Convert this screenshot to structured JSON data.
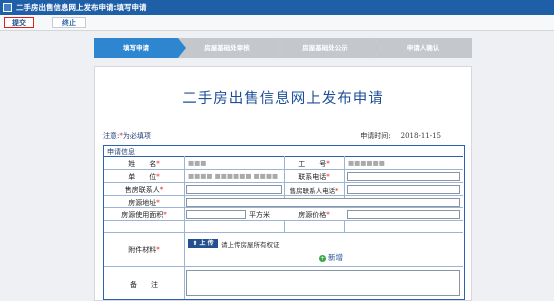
{
  "window": {
    "title": "二手房出售信息网上发布申请:填写申请"
  },
  "toolbar": {
    "submit_label": "提交",
    "stop_label": "终止"
  },
  "steps": [
    {
      "label": "填写申请",
      "active": true
    },
    {
      "label": "房屋基础处审核",
      "active": false
    },
    {
      "label": "房屋基础处公示",
      "active": false
    },
    {
      "label": "申请人确认",
      "active": false
    }
  ],
  "form": {
    "title": "二手房出售信息网上发布申请",
    "notice_prefix": "注意:",
    "notice_star": "*",
    "notice_text": "为必填项",
    "apply_time_label": "申请时间:",
    "apply_time_value": "2018-11-15",
    "section_label": "申请信息",
    "fields": {
      "name_label": "姓　　名",
      "name_value": "■■■",
      "job_no_label": "工　　号",
      "job_no_value": "■■■■■■",
      "unit_label": "单　　位",
      "unit_value": "■■■■ ■■■■■■ ■■■■",
      "phone_label": "联系电话",
      "seller_contact_label": "售房联系人",
      "seller_phone_label": "售房联系人电话",
      "address_label": "房源地址",
      "area_label": "房源使用面积",
      "area_unit": "平方米",
      "price_label": "房源价格",
      "attachment_label": "附件材料",
      "upload_label": "上 传",
      "upload_hint": "请上传房屋所有权证",
      "add_label": "新增",
      "remark_label": "备　　注"
    },
    "required_mark": "*"
  },
  "colors": {
    "accent": "#2b62b0",
    "active_step": "#2f86d0",
    "inactive_step": "#c4c8cd",
    "required": "#dd2222"
  }
}
